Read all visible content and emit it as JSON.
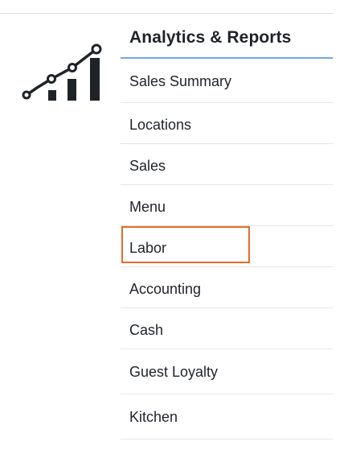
{
  "section": {
    "title": "Analytics & Reports",
    "logo_icon": "analytics-growth-icon"
  },
  "menu": {
    "items": [
      {
        "label": "Sales Summary"
      },
      {
        "label": "Locations"
      },
      {
        "label": "Sales"
      },
      {
        "label": "Menu"
      },
      {
        "label": "Labor",
        "highlighted": true
      },
      {
        "label": "Accounting"
      },
      {
        "label": "Cash"
      },
      {
        "label": "Guest Loyalty"
      },
      {
        "label": "Kitchen"
      }
    ]
  },
  "colors": {
    "accent_underline": "#72a7e8",
    "highlight_border": "#e8692a",
    "icon": "#1f2328"
  }
}
